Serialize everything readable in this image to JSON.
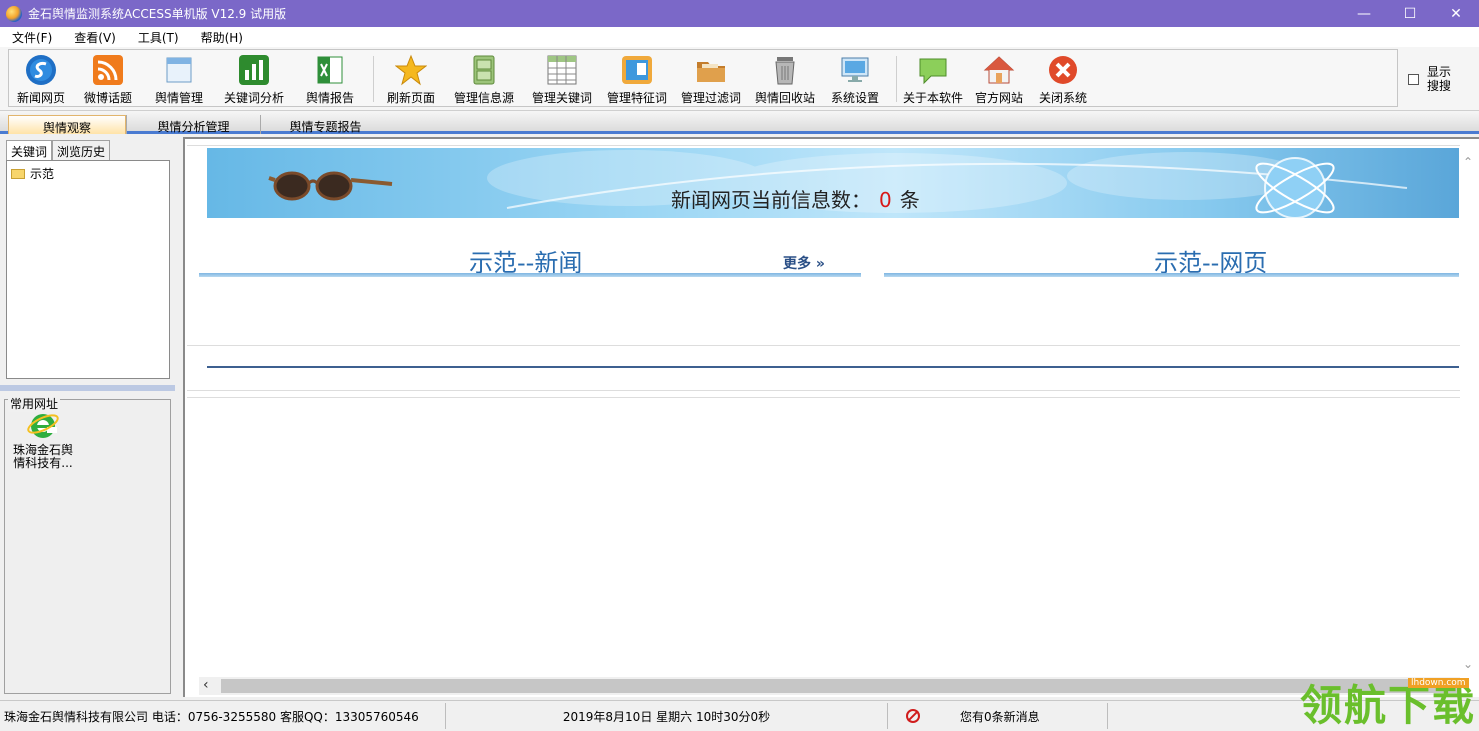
{
  "window": {
    "title": "金石舆情监测系统ACCESS单机版 V12.9 试用版",
    "minimize": "—",
    "maximize": "☐",
    "close": "✕"
  },
  "menu": [
    "文件(F)",
    "查看(V)",
    "工具(T)",
    "帮助(H)"
  ],
  "toolbar": {
    "items": [
      {
        "label": "新闻网页",
        "icon": "news-web-icon"
      },
      {
        "label": "微博话题",
        "icon": "rss-icon"
      },
      {
        "label": "舆情管理",
        "icon": "window-icon"
      },
      {
        "label": "关键词分析",
        "icon": "bar-chart-icon"
      },
      {
        "label": "舆情报告",
        "icon": "excel-icon"
      },
      {
        "label": "刷新页面",
        "icon": "star-icon"
      },
      {
        "label": "管理信息源",
        "icon": "cabinet-icon"
      },
      {
        "label": "管理关键词",
        "icon": "table-icon"
      },
      {
        "label": "管理特征词",
        "icon": "card-icon"
      },
      {
        "label": "管理过滤词",
        "icon": "folder-icon"
      },
      {
        "label": "舆情回收站",
        "icon": "recycle-bin-icon"
      },
      {
        "label": "系统设置",
        "icon": "monitor-icon"
      },
      {
        "label": "关于本软件",
        "icon": "chat-icon"
      },
      {
        "label": "官方网站",
        "icon": "home-icon"
      },
      {
        "label": "关闭系统",
        "icon": "close-circle-icon"
      }
    ],
    "show_search": "显示搜搜"
  },
  "main_tabs": [
    "舆情观察",
    "舆情分析管理",
    "舆情专题报告"
  ],
  "left": {
    "tabs": [
      "关键词",
      "浏览历史"
    ],
    "tree": [
      "示范"
    ],
    "links_title": "常用网址",
    "link_label": "珠海金石舆情科技有..."
  },
  "content": {
    "banner_prefix": "新闻网页当前信息数：",
    "banner_count": "0",
    "banner_unit": "条",
    "section_news": "示范--新闻",
    "section_web": "示范--网页",
    "more": "更多 »"
  },
  "status": {
    "company": "珠海金石舆情科技有限公司 电话：0756-3255580 客服QQ：13305760546",
    "datetime": "2019年8月10日  星期六    10时30分0秒",
    "messages": "您有0条新消息"
  },
  "watermark": {
    "big": "领航下载",
    "small": "lhdown.com"
  }
}
